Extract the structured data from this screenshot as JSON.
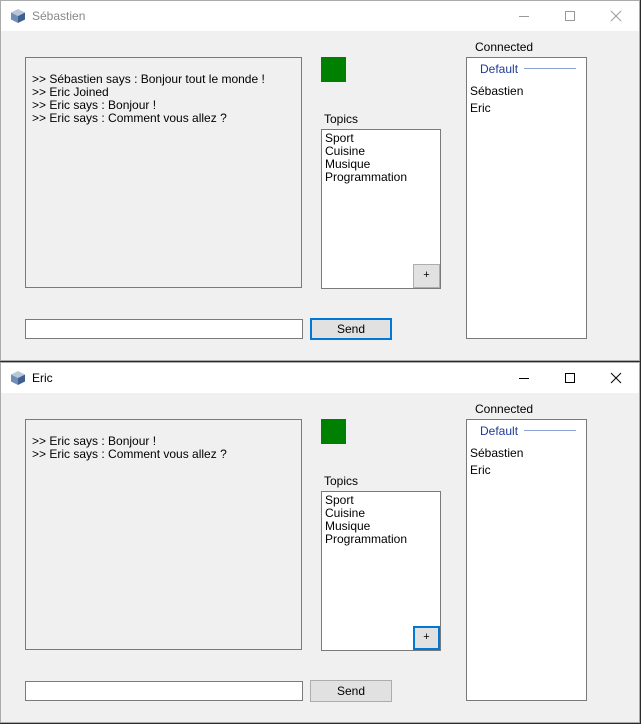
{
  "windows": [
    {
      "title": "Sébastien",
      "chat_lines": [
        ">> Sébastien says : Bonjour tout le monde !",
        ">> Eric Joined",
        ">> Eric says : Bonjour !",
        ">> Eric says : Comment vous allez ?"
      ],
      "status_color": "#008000",
      "topics_label": "Topics",
      "topics": [
        "Sport",
        "Cuisine",
        "Musique",
        "Programmation"
      ],
      "add_topic_label": "+",
      "message_value": "",
      "send_label": "Send",
      "connected_label": "Connected",
      "group_name": "Default",
      "users": [
        "Sébastien",
        "Eric"
      ]
    },
    {
      "title": "Eric",
      "chat_lines": [
        ">> Eric says : Bonjour !",
        ">> Eric says : Comment vous allez ?"
      ],
      "status_color": "#008000",
      "topics_label": "Topics",
      "topics": [
        "Sport",
        "Cuisine",
        "Musique",
        "Programmation"
      ],
      "add_topic_label": "+",
      "message_value": "",
      "send_label": "Send",
      "connected_label": "Connected",
      "group_name": "Default",
      "users": [
        "Sébastien",
        "Eric"
      ]
    }
  ]
}
